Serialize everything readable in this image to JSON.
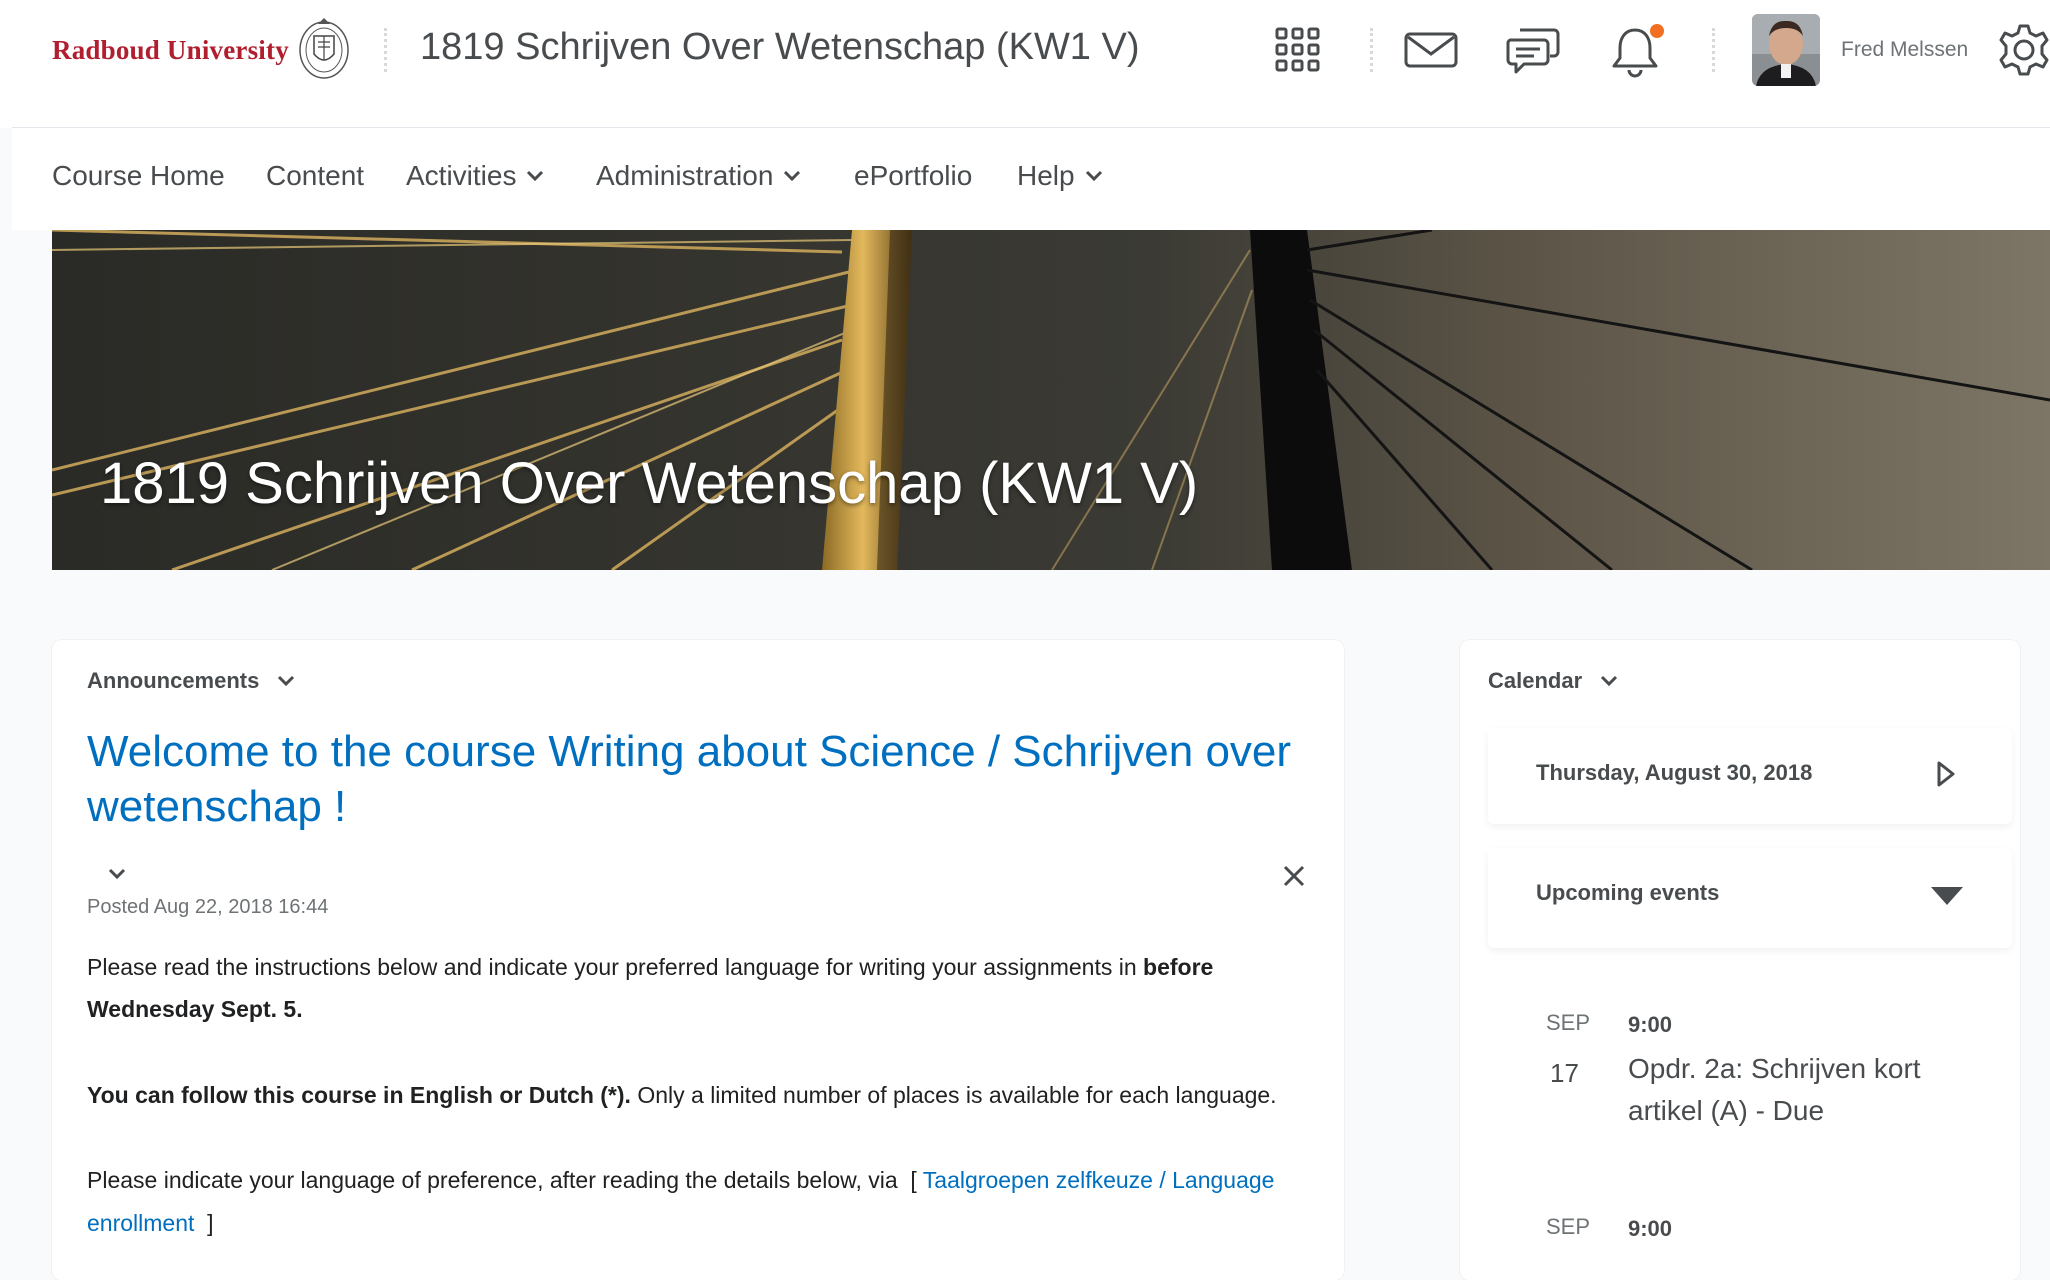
{
  "header": {
    "logo_text": "Radboud University",
    "course_title": "1819 Schrijven Over Wetenschap (KW1 V)",
    "user_name": "Fred Melssen",
    "icons": [
      "grid-icon",
      "mail-icon",
      "chat-icon",
      "bell-icon",
      "gear-icon"
    ],
    "notification_color": "#f26f21"
  },
  "nav": {
    "items": [
      {
        "label": "Course Home"
      },
      {
        "label": "Content"
      },
      {
        "label": "Activities",
        "dropdown": true
      },
      {
        "label": "Administration",
        "dropdown": true
      },
      {
        "label": "ePortfolio"
      },
      {
        "label": "Help",
        "dropdown": true
      }
    ]
  },
  "banner": {
    "title": "1819 Schrijven Over Wetenschap (KW1 V)"
  },
  "announcements": {
    "heading": "Announcements",
    "title": "Welcome to the course Writing about Science / Schrijven over wetenschap !",
    "posted": "Posted Aug 22, 2018 16:44",
    "p1_text": "Please read the instructions below and indicate your preferred language for writing your assignments in ",
    "p1_bold": "before Wednesday Sept. 5.",
    "p2_bold": "You can follow this course in English or Dutch (*).",
    "p2_text": " Only a limited number of places is available for each language.",
    "p3_text": "Please indicate your language of preference, after reading the details below, via",
    "p3_open": "[",
    "p3_link": "Taalgroepen zelfkeuze / Language enrollment",
    "p3_close": "]"
  },
  "calendar": {
    "heading": "Calendar",
    "date": "Thursday, August 30, 2018",
    "upcoming_label": "Upcoming events",
    "events": [
      {
        "month": "SEP",
        "day": "17",
        "time": "9:00",
        "title": "Opdr. 2a: Schrijven kort artikel (A) - Due"
      },
      {
        "month": "SEP",
        "day": "",
        "time": "9:00",
        "title": ""
      }
    ]
  },
  "colors": {
    "link": "#006fbf",
    "brand": "#b01e2f",
    "text": "#494c4e"
  }
}
